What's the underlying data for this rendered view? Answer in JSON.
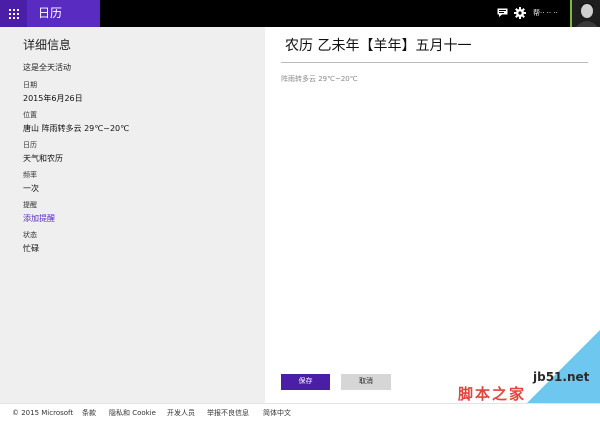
{
  "topbar": {
    "app_title": "日历",
    "user_name": "帮·· ·· ··",
    "icons": [
      "apps-grid-icon",
      "message-icon",
      "gear-icon"
    ],
    "colors": {
      "accent": "#5a2bc0",
      "bar": "#000000",
      "avatar_border": "#7dba3a"
    }
  },
  "details": {
    "heading": "详细信息",
    "all_day": "这是全天活动",
    "fields": [
      {
        "label": "日期",
        "value": "2015年6月26日"
      },
      {
        "label": "位置",
        "value": "唐山 阵雨转多云 29℃~20℃"
      },
      {
        "label": "日历",
        "value": "天气和农历"
      },
      {
        "label": "频率",
        "value": "一次"
      },
      {
        "label": "提醒",
        "value": "添加提醒"
      },
      {
        "label": "状态",
        "value": "忙碌"
      }
    ]
  },
  "event": {
    "title": "农历 乙未年【羊年】五月十一",
    "weather": "阵雨转多云 29℃~20℃",
    "save_label": "保存",
    "cancel_label": "取消"
  },
  "watermark": {
    "site": "jb51.net",
    "name": "脚本之家"
  },
  "footer": {
    "items": [
      "© 2015 Microsoft",
      "条款",
      "隐私和 Cookie",
      "开发人员",
      "举报不良信息",
      "简体中文"
    ]
  }
}
